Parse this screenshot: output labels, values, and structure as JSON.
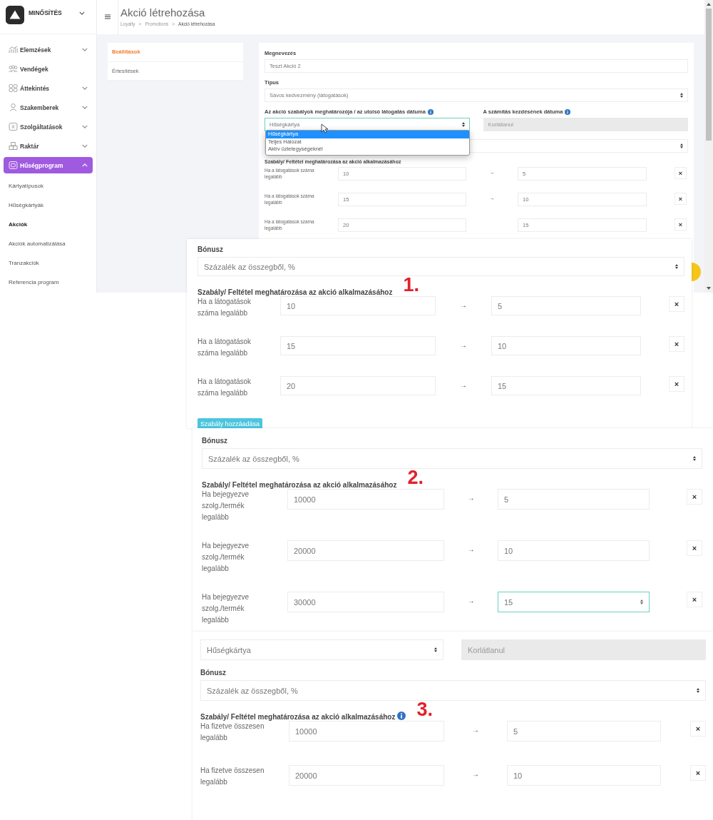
{
  "sidebar": {
    "brand": "MINŐSÍTÉS",
    "items": [
      {
        "label": "Elemzések",
        "expanded": false,
        "selected": false
      },
      {
        "label": "Vendégek",
        "selected": false
      },
      {
        "label": "Áttekintés",
        "expanded": false,
        "selected": false
      },
      {
        "label": "Szakemberek",
        "expanded": false,
        "selected": false
      },
      {
        "label": "Szolgáltatások",
        "expanded": false,
        "selected": false
      },
      {
        "label": "Raktár",
        "expanded": false,
        "selected": false
      },
      {
        "label": "Hűségprogram",
        "expanded": true,
        "selected": true
      }
    ],
    "subitems": [
      {
        "label": "Kártyatípusok",
        "selected": false
      },
      {
        "label": "Hűségkártyák",
        "selected": false
      },
      {
        "label": "Akciók",
        "selected": true
      },
      {
        "label": "Akciók automatizálása",
        "selected": false
      },
      {
        "label": "Tranzakciók",
        "selected": false
      },
      {
        "label": "Referencia program",
        "selected": false
      }
    ]
  },
  "header": {
    "title": "Akció létrehozása",
    "breadcrumb": [
      "Loyalty",
      "Promotions",
      "Akció létrehozása"
    ],
    "separator": ">"
  },
  "tabs": [
    {
      "label": "Beállítások",
      "selected": true
    },
    {
      "label": "Értesítések",
      "selected": false
    }
  ],
  "form": {
    "name_label": "Megnevezés",
    "name_value": "Teszt Akció 2",
    "type_label": "Típus",
    "type_value": "Sávos kedvezmény (látogatások)",
    "basis_label": "Az akció szabályok meghatározója / az utolsó látogatás dátuma",
    "basis_value": "Hűségkártya",
    "basis_options": [
      {
        "label": "Hűségkártya",
        "selected": true
      },
      {
        "label": "Teljes Hálózat",
        "selected": false
      },
      {
        "label": "Aktív üzletegységeknél",
        "selected": false
      }
    ],
    "start_label": "A számítás kezdésének dátuma",
    "start_value": "Korlátlanul",
    "rules_heading": "Szabály/ Feltétel meghatározása az akció alkalmazásához",
    "rows": [
      {
        "condition": "Ha a látogatások száma legalább",
        "from": "10",
        "arrow": "→",
        "to": "5",
        "remove": "×"
      },
      {
        "condition": "Ha a látogatások száma legalább",
        "from": "15",
        "arrow": "→",
        "to": "10",
        "remove": "×"
      },
      {
        "condition": "Ha a látogatások száma legalább",
        "from": "20",
        "to": "15",
        "remove": "×"
      }
    ]
  },
  "panels": [
    {
      "number": "1.",
      "bonus_label": "Bónusz",
      "bonus_value": "Százalék az összegből, %",
      "rules_heading": "Szabály/ Feltétel meghatározása az akció alkalmazásához",
      "heading_info": false,
      "rows": [
        {
          "condition": "Ha a látogatások száma legalább",
          "from": "10",
          "arrow": "→",
          "to": "5",
          "remove": "×",
          "focused": false
        },
        {
          "condition": "Ha a látogatások száma legalább",
          "from": "15",
          "arrow": "→",
          "to": "10",
          "remove": "×",
          "focused": false
        },
        {
          "condition": "Ha a látogatások száma legalább",
          "from": "20",
          "arrow": "→",
          "to": "15",
          "remove": "×",
          "focused": false
        }
      ],
      "add_button": "Szabály hozzáadása"
    },
    {
      "number": "2.",
      "bonus_label": "Bónusz",
      "bonus_value": "Százalék az összegből, %",
      "rules_heading": "Szabály/ Feltétel meghatározása az akció alkalmazásához",
      "heading_info": false,
      "rows": [
        {
          "condition": "Ha bejegyezve szolg./termék legalább",
          "from": "10000",
          "arrow": "→",
          "to": "5",
          "remove": "×",
          "focused": false
        },
        {
          "condition": "Ha bejegyezve szolg./termék legalább",
          "from": "20000",
          "arrow": "→",
          "to": "10",
          "remove": "×",
          "focused": false
        },
        {
          "condition": "Ha bejegyezve szolg./termék legalább",
          "from": "30000",
          "arrow": "→",
          "to": "15",
          "remove": "×",
          "focused": true
        }
      ]
    },
    {
      "number": "3.",
      "basis_value": "Hűségkártya",
      "start_value": "Korlátlanul",
      "bonus_label": "Bónusz",
      "bonus_value": "Százalék az összegből, %",
      "rules_heading": "Szabály/ Feltétel meghatározása az akció alkalmazásához",
      "heading_info": true,
      "rows": [
        {
          "condition": "Ha fizetve összesen legalább",
          "from": "10000",
          "arrow": "→",
          "to": "5",
          "remove": "×",
          "focused": false
        },
        {
          "condition": "Ha fizetve összesen legalább",
          "from": "20000",
          "arrow": "→",
          "to": "10",
          "remove": "×",
          "focused": false
        }
      ]
    }
  ]
}
